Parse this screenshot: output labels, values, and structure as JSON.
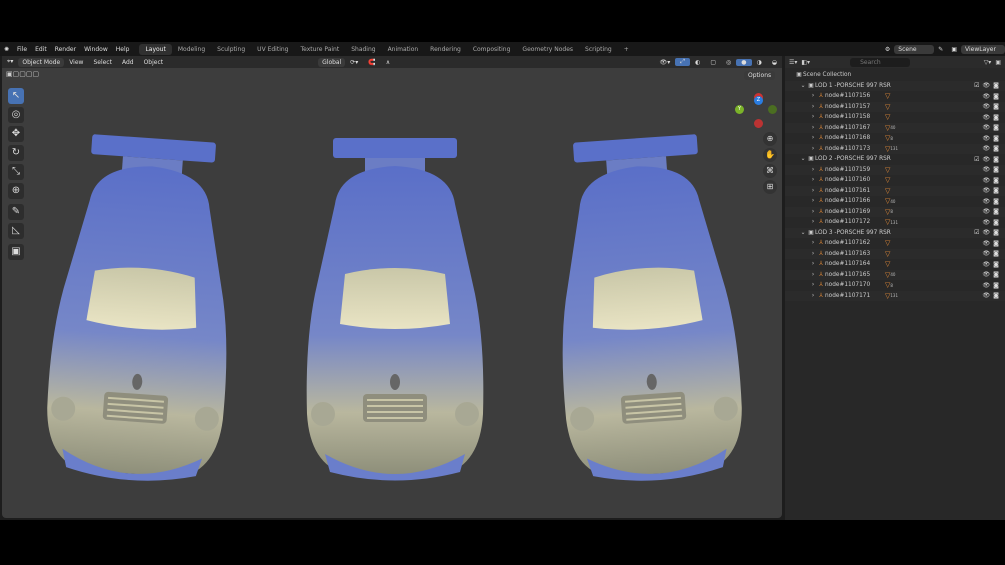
{
  "menu": [
    "File",
    "Edit",
    "Render",
    "Window",
    "Help"
  ],
  "workspaces": [
    "Layout",
    "Modeling",
    "Sculpting",
    "UV Editing",
    "Texture Paint",
    "Shading",
    "Animation",
    "Rendering",
    "Compositing",
    "Geometry Nodes",
    "Scripting",
    "+"
  ],
  "active_workspace": "Layout",
  "scene": "Scene",
  "view_layer": "ViewLayer",
  "header": {
    "mode": "Object Mode",
    "view": "View",
    "select": "Select",
    "add": "Add",
    "object": "Object",
    "orientation": "Global",
    "options": "Options"
  },
  "outliner": {
    "search_placeholder": "Search",
    "root": "Scene Collection",
    "collections": [
      {
        "name": "LOD 1 -PORSCHE 997 RSR",
        "nodes": [
          {
            "name": "node#1107156",
            "badge": ""
          },
          {
            "name": "node#1107157",
            "badge": ""
          },
          {
            "name": "node#1107158",
            "badge": ""
          },
          {
            "name": "node#1107167",
            "badge": "40"
          },
          {
            "name": "node#1107168",
            "badge": "8"
          },
          {
            "name": "node#1107173",
            "badge": "131"
          }
        ]
      },
      {
        "name": "LOD 2 -PORSCHE 997 RSR",
        "nodes": [
          {
            "name": "node#1107159",
            "badge": ""
          },
          {
            "name": "node#1107160",
            "badge": ""
          },
          {
            "name": "node#1107161",
            "badge": ""
          },
          {
            "name": "node#1107166",
            "badge": "40"
          },
          {
            "name": "node#1107169",
            "badge": "8"
          },
          {
            "name": "node#1107172",
            "badge": "131"
          }
        ]
      },
      {
        "name": "LOD 3 -PORSCHE 997 RSR",
        "nodes": [
          {
            "name": "node#1107162",
            "badge": ""
          },
          {
            "name": "node#1107163",
            "badge": ""
          },
          {
            "name": "node#1107164",
            "badge": ""
          },
          {
            "name": "node#1107165",
            "badge": "40"
          },
          {
            "name": "node#1107170",
            "badge": "8"
          },
          {
            "name": "node#1107171",
            "badge": "131"
          }
        ]
      }
    ]
  },
  "gizmo": {
    "x": "X",
    "y": "Y",
    "z": "Z"
  },
  "colors": {
    "accent": "#4772b3",
    "viewport": "#3d3d3d",
    "car_top": "#5b72c9",
    "car_bottom": "#d8d2a8"
  }
}
